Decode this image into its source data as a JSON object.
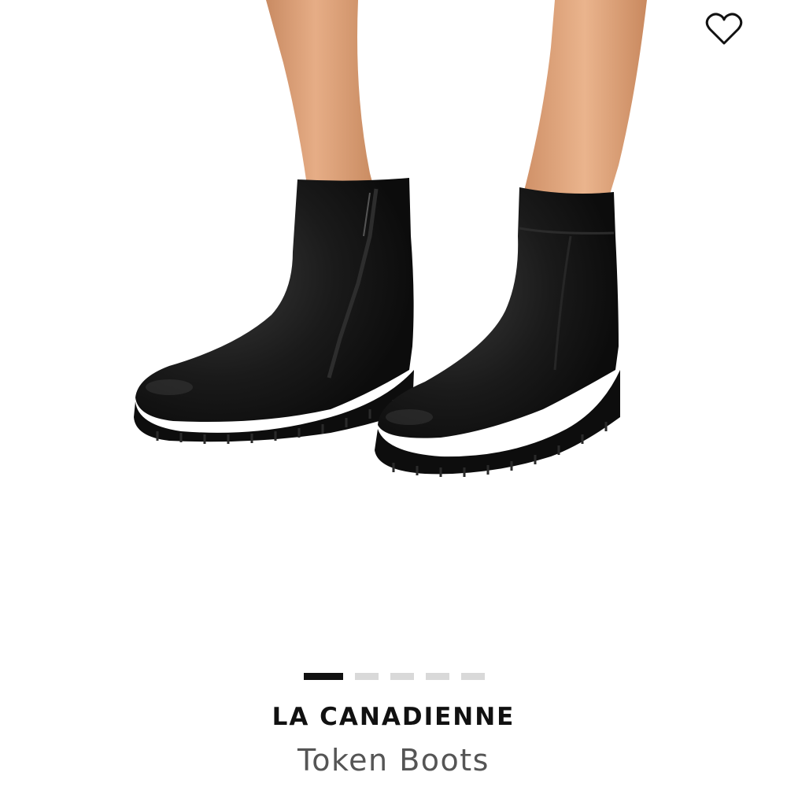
{
  "product": {
    "brand": "LA CANADIENNE",
    "name": "Token Boots"
  },
  "wishlist": {
    "icon": "heart-outline-icon",
    "selected": false
  },
  "carousel": {
    "total": 5,
    "active_index": 0
  },
  "colors": {
    "accent": "#111111",
    "inactive_dot": "#d9d9d9",
    "brand_text": "#111111",
    "product_text": "#555555",
    "skin": "#e0a67f",
    "boot": "#141414"
  }
}
